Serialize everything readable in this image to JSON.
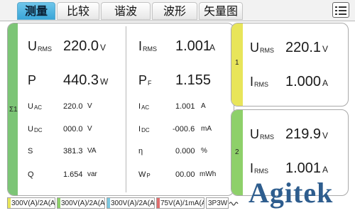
{
  "tabs": [
    {
      "label": "测量",
      "active": true
    },
    {
      "label": "比较",
      "active": false
    },
    {
      "label": "谐波",
      "active": false
    },
    {
      "label": "波形",
      "active": false
    },
    {
      "label": "矢量图",
      "active": false
    }
  ],
  "icons": {
    "menu": "menu-list-icon",
    "waveform": "waveform-icon"
  },
  "colors": {
    "sigma_strip": "#7cc576",
    "ch1_strip": "#e8e55a",
    "ch2_strip": "#8ed06a",
    "active_tab": "#48b0e0",
    "logo": "#2e5d8e"
  },
  "sigma": {
    "label": "Σ1",
    "left": [
      {
        "sym": "U",
        "sub": "RMS",
        "value": "220.0",
        "unit": "V"
      },
      {
        "sym": "P",
        "sub": "",
        "value": "440.3",
        "unit": "W"
      },
      {
        "sym": "U",
        "sub": "AC",
        "value": "220.0",
        "unit": "V"
      },
      {
        "sym": "U",
        "sub": "DC",
        "value": "000.0",
        "unit": "V"
      },
      {
        "sym": "S",
        "sub": "",
        "value": "381.3",
        "unit": "VA"
      },
      {
        "sym": "Q",
        "sub": "",
        "value": "1.654",
        "unit": "var"
      }
    ],
    "right": [
      {
        "sym": "I",
        "sub": "RMS",
        "value": "1.001",
        "unit": "A"
      },
      {
        "sym": "P",
        "sub": "F",
        "value": "1.155",
        "unit": ""
      },
      {
        "sym": "I",
        "sub": "AC",
        "value": "1.001",
        "unit": "A"
      },
      {
        "sym": "I",
        "sub": "DC",
        "value": "-000.6",
        "unit": "mA"
      },
      {
        "sym": "η",
        "sub": "",
        "value": "0.000",
        "unit": "%"
      },
      {
        "sym": "W",
        "sub": "P",
        "value": "00.00",
        "unit": "mWh"
      }
    ]
  },
  "ch1": {
    "label": "1",
    "rows": [
      {
        "sym": "U",
        "sub": "RMS",
        "value": "220.1",
        "unit": "V"
      },
      {
        "sym": "I",
        "sub": "RMS",
        "value": "1.000",
        "unit": "A"
      }
    ]
  },
  "ch2": {
    "label": "2",
    "rows": [
      {
        "sym": "U",
        "sub": "RMS",
        "value": "219.9",
        "unit": "V"
      },
      {
        "sym": "I",
        "sub": "RMS",
        "value": "1.001",
        "unit": "A"
      }
    ]
  },
  "status": {
    "ranges": [
      {
        "text": "300V(A)/2A(A)",
        "color": "#e8e55a"
      },
      {
        "text": "300V(A)/2A(A)",
        "color": "#8ed06a"
      },
      {
        "text": "300V(A)/2A(A)",
        "color": "#7cc8e0"
      },
      {
        "text": "75V(A)/1mA(A)",
        "color": "#e07070"
      }
    ],
    "wiring": "3P3W"
  },
  "logo": "Agitek"
}
